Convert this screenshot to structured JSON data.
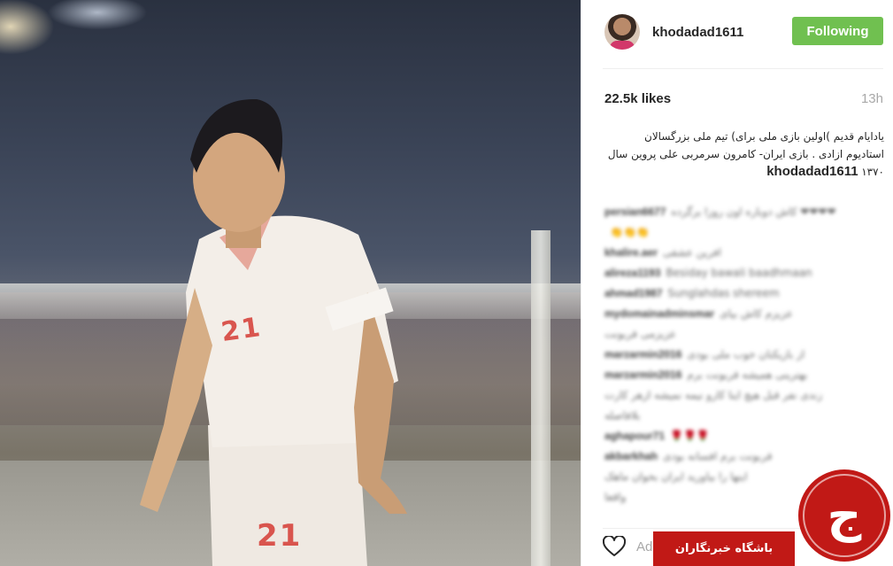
{
  "post": {
    "photo_alt": "",
    "shirt_number_chest": "21",
    "shirt_number_shorts": "21"
  },
  "header": {
    "username": "khodadad1611",
    "follow_button": "Following"
  },
  "stats": {
    "likes": "22.5k likes",
    "time_ago": "13h"
  },
  "caption": {
    "username": "khodadad1611",
    "text": "یادایام قدیم )اولین بازی ملی برای) تیم ملی بزرگسالان استادیوم ازادی . بازی ایران- کامرون سرمربی علی پروین سال ۱۳۷۰"
  },
  "comments": [
    {
      "user": "persian6677",
      "text": "کاش دوباره اون روزا برگرده ❤❤❤❤"
    },
    {
      "user": "",
      "text": "👏👏👏"
    },
    {
      "user": "khalire.aer",
      "text": "افرین عشقی"
    },
    {
      "user": "alireza1193",
      "text": "Besiday bawali baadhmaan"
    },
    {
      "user": "ahmad1987",
      "text": "Sunglahdas shereem"
    },
    {
      "user": "mydomainadminsmar",
      "text": "عزیزم کاش بیای"
    },
    {
      "user": "",
      "text": "عزیزمی قربونت"
    },
    {
      "user": "marzarmin2016",
      "text": "از بازیکنان خوب ملی بودی"
    },
    {
      "user": "marzarmin2016",
      "text": "بهترینی همیشه قربونت برم"
    },
    {
      "user": "",
      "text": "زندی نفر قبل هیچ اینا کارو نیمه نمیشه ازهر کارت"
    },
    {
      "user": "",
      "text": "بلافاصله"
    },
    {
      "user": "aghapour71",
      "text": "🌹🌹🌹"
    },
    {
      "user": "akbarkhah",
      "text": "قربونت برم افسانه بودی"
    },
    {
      "user": "",
      "text": "اینها را بیاورید ایران بخوان ماهک"
    },
    {
      "user": "",
      "text": "واقعا"
    }
  ],
  "footer": {
    "add_comment_placeholder": "Add a comment..."
  },
  "watermark": {
    "badge_text": "باشگاه خبرنگاران",
    "logo_glyph": "ج"
  },
  "colors": {
    "follow_button_bg": "#70c050",
    "watermark_red": "#c11916"
  },
  "icons": {
    "like": "heart-outline-icon",
    "avatar": "profile-avatar"
  }
}
